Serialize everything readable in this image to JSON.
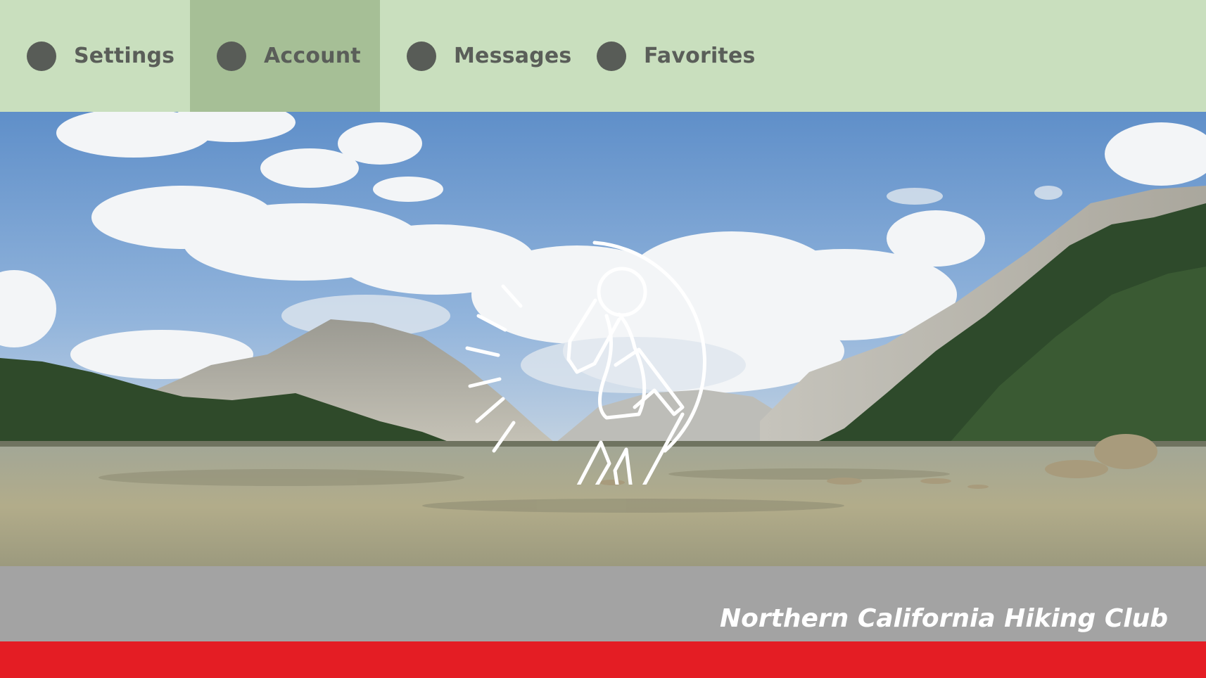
{
  "nav": {
    "items": [
      {
        "label": "Settings",
        "icon": "circle-icon",
        "active": false
      },
      {
        "label": "Account",
        "icon": "circle-icon",
        "active": true
      },
      {
        "label": "Messages",
        "icon": "circle-icon",
        "active": false
      },
      {
        "label": "Favorites",
        "icon": "circle-icon",
        "active": false
      }
    ]
  },
  "hero": {
    "logo_icon": "hiker-icon"
  },
  "footer": {
    "club_name": "Northern California Hiking Club"
  },
  "colors": {
    "nav_background": "#c9dfbe",
    "nav_active": "#a6bf96",
    "footer_gray": "#a3a3a3",
    "accent_red": "#e41d24"
  }
}
